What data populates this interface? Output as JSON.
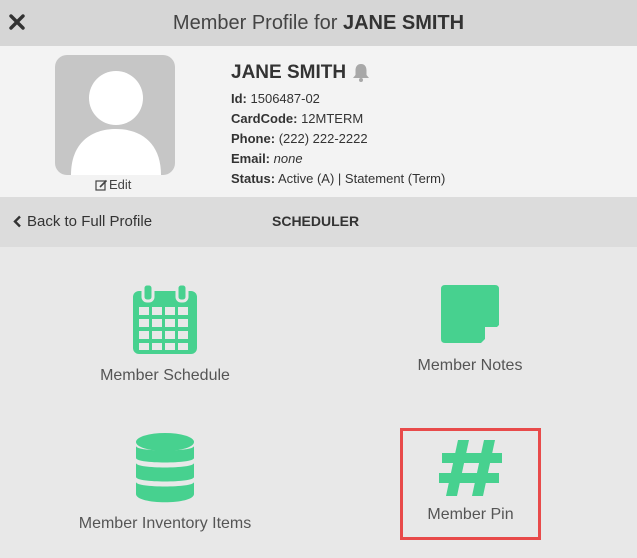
{
  "header": {
    "title_prefix": "Member Profile for",
    "title_name": "JANE SMITH"
  },
  "profile": {
    "edit_label": "Edit",
    "name": "JANE SMITH",
    "fields": {
      "id_label": "Id:",
      "id": "1506487-02",
      "cardcode_label": "CardCode:",
      "cardcode": "12MTERM",
      "phone_label": "Phone:",
      "phone": "(222) 222-2222",
      "email_label": "Email:",
      "email": "none",
      "status_label": "Status:",
      "status": "Active (A) | Statement (Term)"
    }
  },
  "nav": {
    "back_label": "Back to Full Profile",
    "section_title": "SCHEDULER"
  },
  "tiles": [
    {
      "label": "Member Schedule",
      "icon": "calendar-icon"
    },
    {
      "label": "Member Notes",
      "icon": "sticky-note-icon"
    },
    {
      "label": "Member Inventory Items",
      "icon": "database-icon"
    },
    {
      "label": "Member Pin",
      "icon": "hashtag-icon"
    }
  ],
  "colors": {
    "accent": "#47d18f",
    "highlight": "#e84a4a",
    "header_bg": "#d6d6d6"
  }
}
